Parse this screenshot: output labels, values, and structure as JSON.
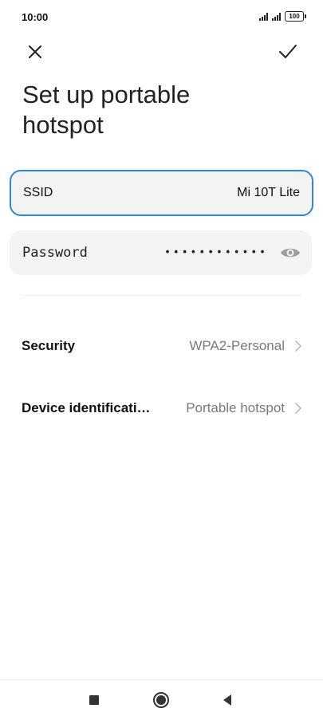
{
  "status_bar": {
    "time": "10:00",
    "battery": "100",
    "icons": [
      "signal-icon",
      "signal-icon",
      "battery-icon"
    ]
  },
  "top_actions": {
    "close_icon": "close-icon",
    "confirm_icon": "checkmark-icon"
  },
  "title": "Set up portable hotspot",
  "ssid": {
    "label": "SSID",
    "value": "Mi 10T Lite",
    "focus_color": "#2f87d9"
  },
  "password": {
    "label": "Password",
    "masked_value": "••••••••••••",
    "toggle_icon": "eye-icon"
  },
  "settings": [
    {
      "label": "Security",
      "value": "WPA2-Personal"
    },
    {
      "label": "Device identificati…",
      "value": "Portable hotspot"
    }
  ],
  "nav_bar": {
    "recents_icon": "square-icon",
    "home_icon": "circle-icon",
    "back_icon": "triangle-back-icon"
  }
}
